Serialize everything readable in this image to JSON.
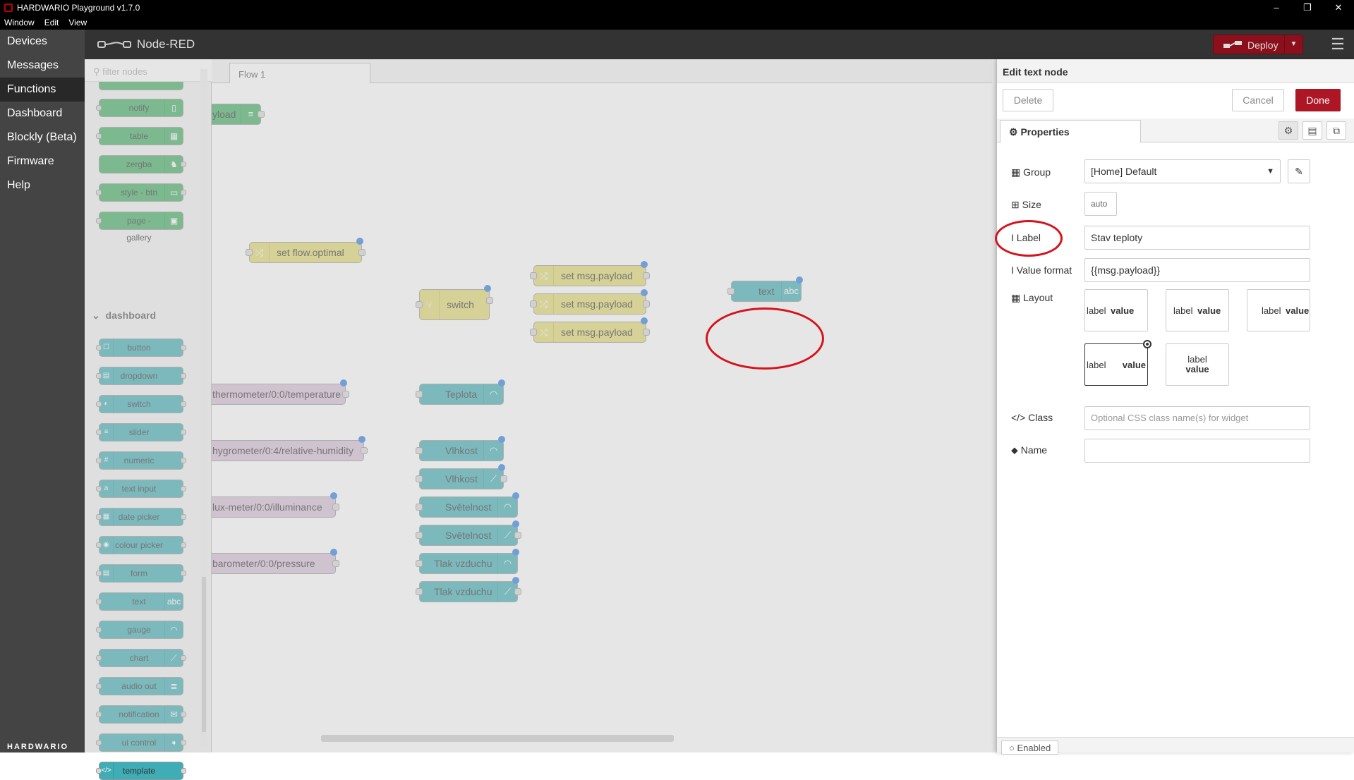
{
  "window": {
    "title": "HARDWARIO Playground v1.7.0",
    "minimize": "–",
    "maximize": "❐",
    "close": "✕"
  },
  "menu": [
    "Window",
    "Edit",
    "View"
  ],
  "nav": {
    "items": [
      "Devices",
      "Messages",
      "Functions",
      "Dashboard",
      "Blockly (Beta)",
      "Firmware",
      "Help"
    ],
    "active": "Functions",
    "brand": "HARDWARIO"
  },
  "header": {
    "title": "Node-RED",
    "deploy_label": "Deploy",
    "menu_icon": "hamburger-icon"
  },
  "palette": {
    "filter_placeholder": "filter nodes",
    "category": "dashboard",
    "top_nodes": [
      "notify",
      "table",
      "zergba",
      "style - btn",
      "page - gallery"
    ],
    "dashboard_nodes": [
      "button",
      "dropdown",
      "switch",
      "slider",
      "numeric",
      "text input",
      "date picker",
      "colour picker",
      "form",
      "text",
      "gauge",
      "chart",
      "audio out",
      "notification",
      "ui control",
      "template"
    ]
  },
  "workspace": {
    "tab": "Flow 1",
    "nodes": {
      "payload_partial": "yload",
      "set_flow": "set flow.optimal",
      "change1": "set msg.payload",
      "change2": "set msg.payload",
      "change3": "set msg.payload",
      "switch": "switch",
      "text": "text",
      "thermo": "thermometer/0:0/temperature",
      "teplota": "Teplota",
      "hygro": "hygrometer/0:4/relative-humidity",
      "vlhkost1": "Vlhkost",
      "vlhkost2": "Vlhkost",
      "lux": "lux-meter/0:0/illuminance",
      "svetelnost1": "Světelnost",
      "svetelnost2": "Světelnost",
      "baro": "barometer/0:0/pressure",
      "tlak1": "Tlak vzduchu",
      "tlak2": "Tlak vzduchu"
    }
  },
  "editor": {
    "title": "Edit text node",
    "delete": "Delete",
    "cancel": "Cancel",
    "done": "Done",
    "tab_properties": "Properties",
    "group_label": "Group",
    "group_value": "[Home] Default",
    "size_label": "Size",
    "size_value": "auto",
    "label_label": "Label",
    "label_value": "Stav teploty",
    "format_label": "Value format",
    "format_value": "{{msg.payload}}",
    "layout_label": "Layout",
    "layout_word_label": "label",
    "layout_word_value": "value",
    "class_label": "Class",
    "class_placeholder": "Optional CSS class name(s) for widget",
    "name_label": "Name",
    "name_value": "",
    "enabled": "Enabled"
  },
  "colors": {
    "accent": "#ad1625",
    "highlight_circle": "#d6131c",
    "function_node": "#e2d96e",
    "dashboard_node": "#3fadb5",
    "mqtt_node": "#d8bfd8"
  }
}
